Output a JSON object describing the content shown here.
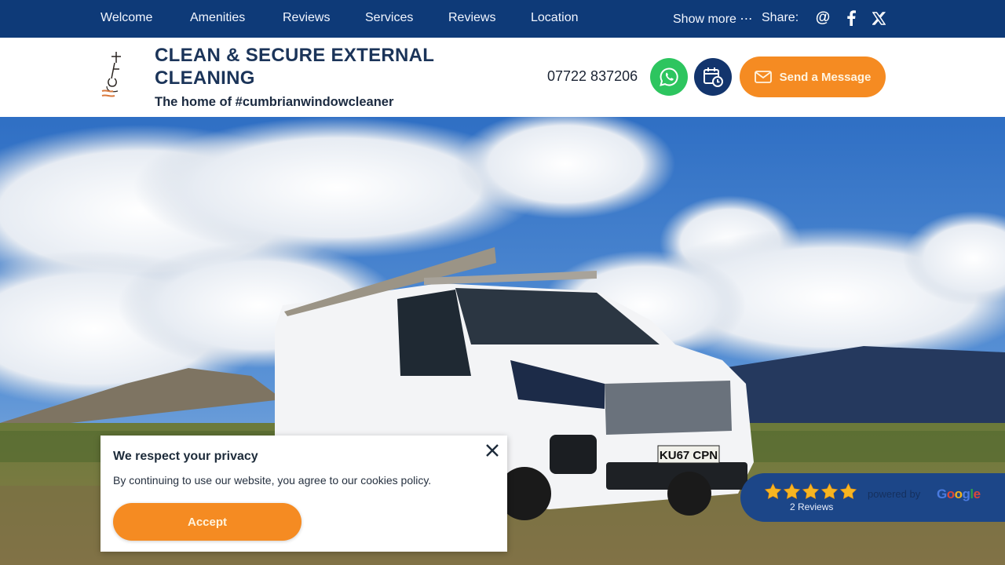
{
  "nav": {
    "items": [
      {
        "label": "Welcome"
      },
      {
        "label": "Amenities"
      },
      {
        "label": "Reviews"
      },
      {
        "label": "Services"
      },
      {
        "label": "Reviews"
      },
      {
        "label": "Location"
      }
    ],
    "show_more": "Show more ⋯",
    "share_label": "Share:",
    "share_icons": [
      "email-at-icon",
      "facebook-icon",
      "x-twitter-icon"
    ]
  },
  "header": {
    "title": "CLEAN & SECURE EXTERNAL CLEANING",
    "tagline": "The home of #cumbrianwindowcleaner",
    "phone": "07722 837206",
    "send_message_label": "Send a Message"
  },
  "cookie_banner": {
    "title": "We respect your privacy",
    "text": "By continuing to use our website, you agree to our cookies policy.",
    "accept_label": "Accept"
  },
  "reviews_badge": {
    "rating": 5,
    "max_rating": 5,
    "count_label": "2 Reviews",
    "powered_by": "powered by",
    "provider": "Google"
  },
  "hero": {
    "van_plate": "KU67 CPN"
  },
  "colors": {
    "nav_bg": "#0e3a78",
    "accent_orange": "#f58b22",
    "whatsapp_green": "#2dc55f",
    "calendar_navy": "#13356d",
    "title_navy": "#1b3459"
  }
}
